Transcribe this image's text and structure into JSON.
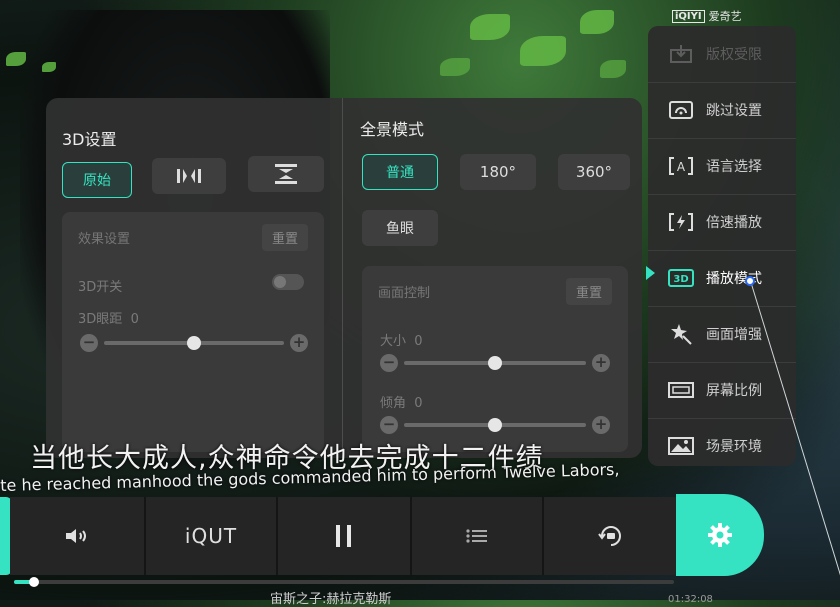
{
  "colors": {
    "accent": "#35e3c2",
    "panel": "#303030"
  },
  "logo": {
    "mark": "iQIYI",
    "text": "爱奇艺"
  },
  "settings_3d": {
    "title": "3D设置",
    "modes": [
      {
        "label": "原始",
        "selected": true
      },
      {
        "icon": "side-by-side-icon"
      },
      {
        "icon": "top-bottom-icon"
      }
    ],
    "effect": {
      "header": "效果设置",
      "reset_label": "重置",
      "switch_label": "3D开关",
      "switch_on": false,
      "distance_label": "3D眼距",
      "distance_value": "0",
      "distance_level": 0.5
    }
  },
  "panorama": {
    "title": "全景模式",
    "modes": [
      {
        "label": "普通",
        "selected": true
      },
      {
        "label": "180°"
      },
      {
        "label": "360°"
      },
      {
        "label": "鱼眼"
      }
    ],
    "control": {
      "header": "画面控制",
      "reset_label": "重置",
      "size_label": "大小",
      "size_value": "0",
      "size_level": 0.5,
      "tilt_label": "倾角",
      "tilt_value": "0",
      "tilt_level": 0.5
    }
  },
  "menu": {
    "items": [
      {
        "label": "版权受限",
        "icon": "download-icon",
        "state": "disabled"
      },
      {
        "label": "跳过设置",
        "icon": "skip-icon",
        "state": "normal"
      },
      {
        "label": "语言选择",
        "icon": "language-icon",
        "state": "normal"
      },
      {
        "label": "倍速播放",
        "icon": "speed-icon",
        "state": "normal"
      },
      {
        "label": "播放模式",
        "icon": "3d-icon",
        "state": "active"
      },
      {
        "label": "画面增强",
        "icon": "magic-wand-icon",
        "state": "normal"
      },
      {
        "label": "屏幕比例",
        "icon": "aspect-ratio-icon",
        "state": "normal"
      },
      {
        "label": "场景环境",
        "icon": "scene-icon",
        "state": "normal"
      }
    ]
  },
  "subtitles": {
    "zh": "当他长大成人,众神命令他去完成十二件绩",
    "en": "te he reached manhood the gods commanded him to perform Twelve Labors,"
  },
  "controls": {
    "quality_label": "iQUT",
    "progress": 0.03
  },
  "video": {
    "title": "宙斯之子:赫拉克勒斯",
    "time": "01:32:08"
  }
}
